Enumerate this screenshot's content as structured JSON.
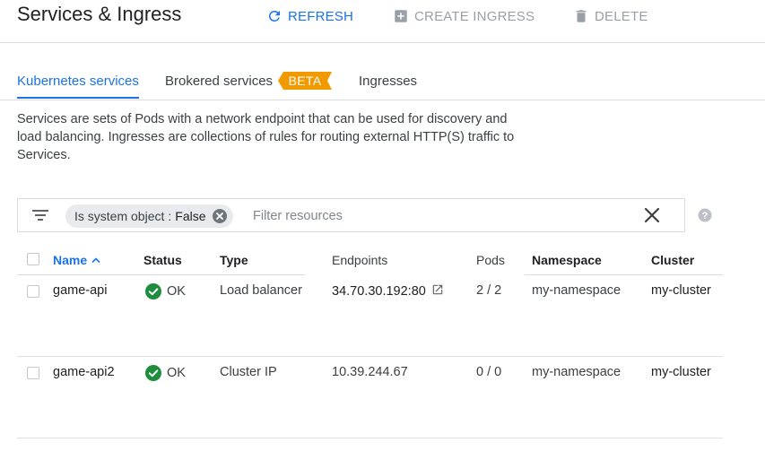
{
  "header": {
    "title": "Services & Ingress",
    "refresh_label": "REFRESH",
    "create_ingress_label": "CREATE INGRESS",
    "delete_label": "DELETE"
  },
  "tabs": [
    {
      "label": "Kubernetes services",
      "active": true
    },
    {
      "label": "Brokered services",
      "badge": "BETA"
    },
    {
      "label": "Ingresses"
    }
  ],
  "description": "Services are sets of Pods with a network endpoint that can be used for discovery and load balancing. Ingresses are collections of rules for routing external HTTP(S) traffic to Services.",
  "filter": {
    "chip_key": "Is system object",
    "chip_separator": ":",
    "chip_value": "False",
    "placeholder": "Filter resources"
  },
  "table": {
    "columns": [
      "Name",
      "Status",
      "Type",
      "Endpoints",
      "Pods",
      "Namespace",
      "Cluster"
    ],
    "rows": [
      {
        "name": "game-api",
        "status": "OK",
        "type": "Load balancer",
        "endpoints": "34.70.30.192:80",
        "pods": "2 / 2",
        "namespace": "my-namespace",
        "cluster": "my-cluster"
      },
      {
        "name": "game-api2",
        "status": "OK",
        "type": "Cluster IP",
        "endpoints": "10.39.244.67",
        "pods": "0 / 0",
        "namespace": "my-namespace",
        "cluster": "my-cluster"
      }
    ]
  },
  "colors": {
    "accent": "#1a73e8",
    "ok_green": "#1e8e3e",
    "beta_orange": "#f29900",
    "disabled": "#9aa0a6"
  }
}
